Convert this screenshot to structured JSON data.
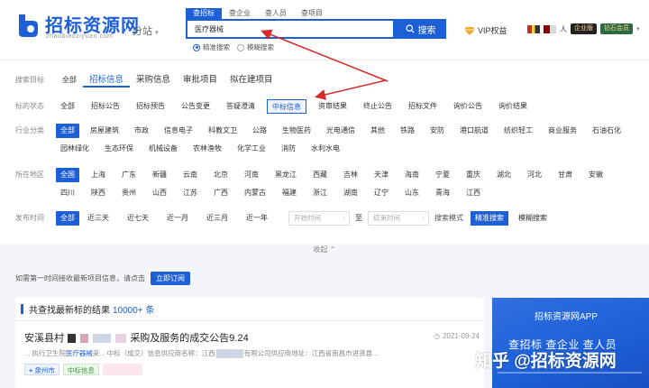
{
  "brand": {
    "logo_text": "招标资源网",
    "logo_sub": "zhaobiaoziyuan.com",
    "substation": "分站"
  },
  "search": {
    "tabs": [
      "查招标",
      "查企业",
      "查人员",
      "查项目"
    ],
    "active_tab": "查招标",
    "value": "医疗器械",
    "button": "搜索",
    "options": [
      "精准搜索",
      "模糊搜索"
    ]
  },
  "user": {
    "vip_label": "VIP权益",
    "name_suffix": "人",
    "badge_enterprise": "企业版",
    "badge_diamond": "钻石会员"
  },
  "filters": {
    "target": {
      "label": "搜索目标",
      "options": [
        "全部",
        "招标信息",
        "采购信息",
        "审批项目",
        "拟在建项目"
      ]
    },
    "status": {
      "label": "标的状态",
      "options": [
        "全部",
        "招标公告",
        "招标预告",
        "公告变更",
        "答疑澄清",
        "中标信息",
        "资审结果",
        "终止公告",
        "招标文件",
        "询价公告",
        "询价结果"
      ]
    },
    "industry": {
      "label": "行业分类",
      "options": [
        "全部",
        "房屋建筑",
        "市政",
        "信息电子",
        "科教文卫",
        "公路",
        "生物医药",
        "光电通信",
        "其他",
        "铁路",
        "安防",
        "港口航道",
        "纺织轻工",
        "商业服务",
        "石油石化",
        "园林绿化",
        "生态环保",
        "机械设备",
        "农林渔牧",
        "化学工业",
        "消防",
        "水利水电"
      ]
    },
    "region": {
      "label": "所在地区",
      "options": [
        "全国",
        "上海",
        "广东",
        "新疆",
        "云南",
        "北京",
        "河南",
        "黑龙江",
        "西藏",
        "吉林",
        "天津",
        "海南",
        "宁夏",
        "重庆",
        "湖北",
        "河北",
        "甘肃",
        "安徽",
        "四川",
        "陕西",
        "贵州",
        "山西",
        "江苏",
        "广西",
        "内蒙古",
        "福建",
        "浙江",
        "湖南",
        "辽宁",
        "山东",
        "青海",
        "江西"
      ]
    },
    "time": {
      "label": "发布时间",
      "options": [
        "全部",
        "近三天",
        "近七天",
        "近一月",
        "近三月",
        "近一年"
      ],
      "start_placeholder": "开始时间",
      "end_placeholder": "结束时间",
      "separator": "至",
      "mode_label": "搜索模式",
      "modes": [
        "精准搜索",
        "模糊搜索"
      ]
    }
  },
  "collapse_label": "收起 ⌃",
  "subscribe": {
    "text": "如需第一时间接收最新项目信息，请点击",
    "button": "立即订阅"
  },
  "results": {
    "title": "共查找最新标的结果",
    "count": "10000+ 条",
    "item": {
      "title_start": "安溪县村",
      "title_end": "采购及服务的成交公告9.24",
      "date": "2021-09-24",
      "desc_1": "... 执行卫生院",
      "desc_hl": "医疗器械",
      "desc_2": "采... 中标（成交）信息供应商名称：江西",
      "desc_3": "有限公司供应商地址：江西省南昌市进贤县...",
      "tag_location": "泉州市",
      "tag_category": "中标信息"
    }
  },
  "side": {
    "title": "招标资源网APP",
    "slogan": "查招标 查企业 查人员"
  },
  "watermark": "知乎 @招标资源网",
  "colors": {
    "primary": "#1d5fd6",
    "annotation_arrow": "#d62b2b"
  }
}
